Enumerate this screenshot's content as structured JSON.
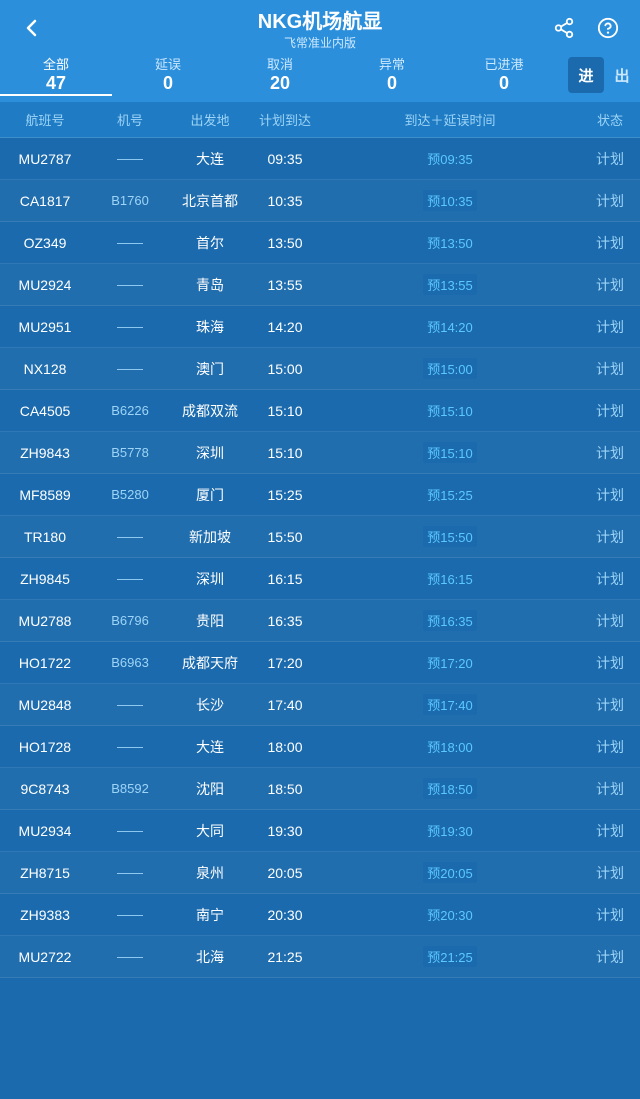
{
  "header": {
    "title": "NKG机场航显",
    "subtitle": "飞常准业内版",
    "back_icon": "‹",
    "share_icon": "share",
    "help_icon": "?"
  },
  "tabs": [
    {
      "id": "all",
      "label": "全部",
      "count": "47"
    },
    {
      "id": "delay",
      "label": "延误",
      "count": "0"
    },
    {
      "id": "cancel",
      "label": "取消",
      "count": "20"
    },
    {
      "id": "abnormal",
      "label": "异常",
      "count": "0"
    },
    {
      "id": "arrived",
      "label": "已进港",
      "count": "0"
    }
  ],
  "active_tab": "all",
  "direction": {
    "in_label": "进",
    "out_label": "出",
    "active": "in"
  },
  "columns": {
    "flight": "航班号",
    "plane": "机号",
    "origin": "出发地",
    "sched": "计划到达",
    "eta": "到达＋延误时间",
    "status": "状态"
  },
  "rows": [
    {
      "flight": "MU2787",
      "plane": "——",
      "origin": "大连",
      "sched": "09:35",
      "eta_prefix": "预",
      "eta_time": "09:35",
      "status": "计划"
    },
    {
      "flight": "CA1817",
      "plane": "B1760",
      "origin": "北京首都",
      "sched": "10:35",
      "eta_prefix": "预",
      "eta_time": "10:35",
      "status": "计划"
    },
    {
      "flight": "OZ349",
      "plane": "——",
      "origin": "首尔",
      "sched": "13:50",
      "eta_prefix": "预",
      "eta_time": "13:50",
      "status": "计划"
    },
    {
      "flight": "MU2924",
      "plane": "——",
      "origin": "青岛",
      "sched": "13:55",
      "eta_prefix": "预",
      "eta_time": "13:55",
      "status": "计划"
    },
    {
      "flight": "MU2951",
      "plane": "——",
      "origin": "珠海",
      "sched": "14:20",
      "eta_prefix": "预",
      "eta_time": "14:20",
      "status": "计划"
    },
    {
      "flight": "NX128",
      "plane": "——",
      "origin": "澳门",
      "sched": "15:00",
      "eta_prefix": "预",
      "eta_time": "15:00",
      "status": "计划"
    },
    {
      "flight": "CA4505",
      "plane": "B6226",
      "origin": "成都双流",
      "sched": "15:10",
      "eta_prefix": "预",
      "eta_time": "15:10",
      "status": "计划"
    },
    {
      "flight": "ZH9843",
      "plane": "B5778",
      "origin": "深圳",
      "sched": "15:10",
      "eta_prefix": "预",
      "eta_time": "15:10",
      "status": "计划"
    },
    {
      "flight": "MF8589",
      "plane": "B5280",
      "origin": "厦门",
      "sched": "15:25",
      "eta_prefix": "预",
      "eta_time": "15:25",
      "status": "计划"
    },
    {
      "flight": "TR180",
      "plane": "——",
      "origin": "新加坡",
      "sched": "15:50",
      "eta_prefix": "预",
      "eta_time": "15:50",
      "status": "计划"
    },
    {
      "flight": "ZH9845",
      "plane": "——",
      "origin": "深圳",
      "sched": "16:15",
      "eta_prefix": "预",
      "eta_time": "16:15",
      "status": "计划"
    },
    {
      "flight": "MU2788",
      "plane": "B6796",
      "origin": "贵阳",
      "sched": "16:35",
      "eta_prefix": "预",
      "eta_time": "16:35",
      "status": "计划"
    },
    {
      "flight": "HO1722",
      "plane": "B6963",
      "origin": "成都天府",
      "sched": "17:20",
      "eta_prefix": "预",
      "eta_time": "17:20",
      "status": "计划"
    },
    {
      "flight": "MU2848",
      "plane": "——",
      "origin": "长沙",
      "sched": "17:40",
      "eta_prefix": "预",
      "eta_time": "17:40",
      "status": "计划"
    },
    {
      "flight": "HO1728",
      "plane": "——",
      "origin": "大连",
      "sched": "18:00",
      "eta_prefix": "预",
      "eta_time": "18:00",
      "status": "计划"
    },
    {
      "flight": "9C8743",
      "plane": "B8592",
      "origin": "沈阳",
      "sched": "18:50",
      "eta_prefix": "预",
      "eta_time": "18:50",
      "status": "计划"
    },
    {
      "flight": "MU2934",
      "plane": "——",
      "origin": "大同",
      "sched": "19:30",
      "eta_prefix": "预",
      "eta_time": "19:30",
      "status": "计划"
    },
    {
      "flight": "ZH8715",
      "plane": "——",
      "origin": "泉州",
      "sched": "20:05",
      "eta_prefix": "预",
      "eta_time": "20:05",
      "status": "计划"
    },
    {
      "flight": "ZH9383",
      "plane": "——",
      "origin": "南宁",
      "sched": "20:30",
      "eta_prefix": "预",
      "eta_time": "20:30",
      "status": "计划"
    },
    {
      "flight": "MU2722",
      "plane": "——",
      "origin": "北海",
      "sched": "21:25",
      "eta_prefix": "预",
      "eta_time": "21:25",
      "status": "计划"
    }
  ]
}
